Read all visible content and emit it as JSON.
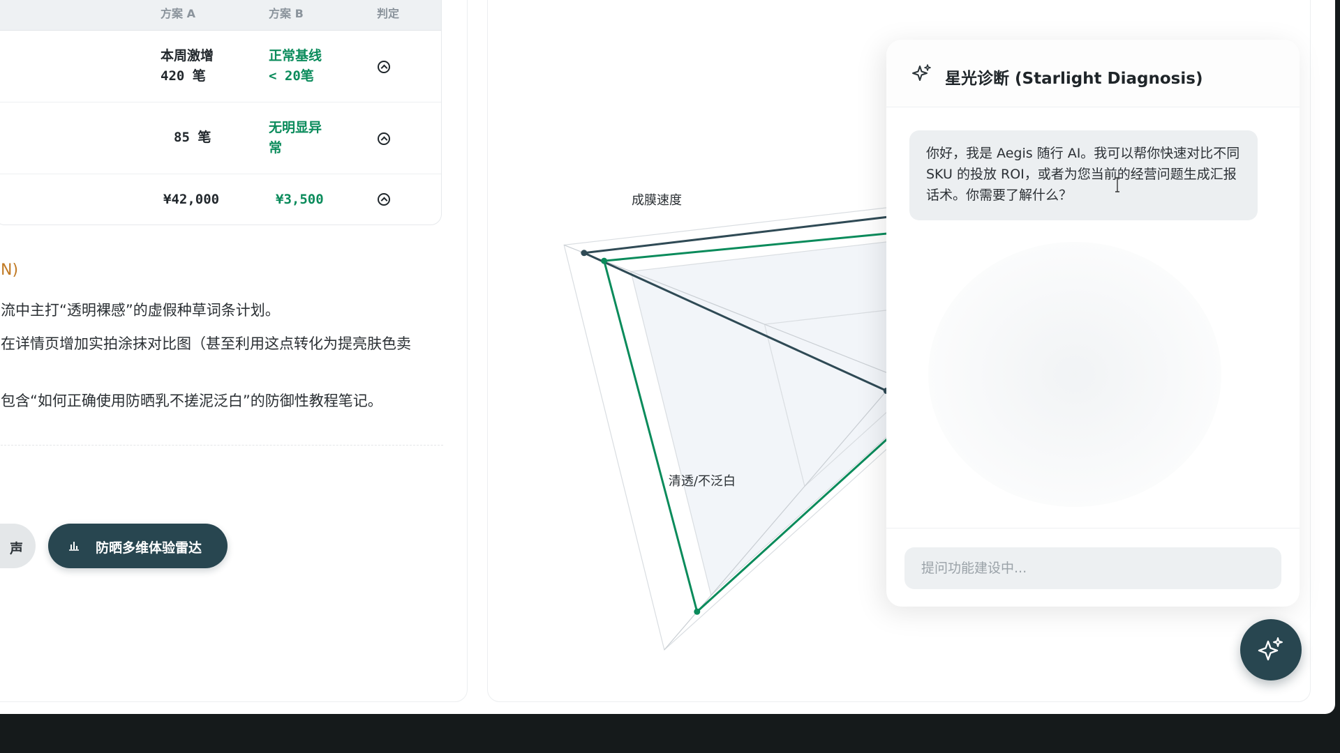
{
  "table": {
    "headers": {
      "a": "方案 A",
      "b": "方案 B",
      "verdict": "判定"
    },
    "rows": [
      {
        "a_line1": "本周激增",
        "a_line2": "420 笔",
        "b_line1": "正常基线",
        "b_line2": "< 20笔"
      },
      {
        "a_line1": "85 笔",
        "b_line1": "无明显异",
        "b_line2": "常"
      },
      {
        "a_line1": "¥42,000",
        "b_line1": "¥3,500"
      }
    ]
  },
  "section": {
    "label": "N)",
    "lines": [
      "流中主打“透明裸感”的虚假种草词条计划。",
      "在详情页增加实拍涂抹对比图（甚至利用这点转化为提亮肤色卖",
      "包含“如何正确使用防晒乳不搓泥泛白”的防御性教程笔记。"
    ]
  },
  "buttons": {
    "ghost_label": "声",
    "radar_label": "防晒多维体验雷达"
  },
  "chart_data": {
    "type": "radar",
    "axes": [
      "",
      "成膜速度",
      "清透/不泛白"
    ],
    "series": [
      {
        "color": "#2f4a55",
        "values": [
          0.95,
          0.94,
          0.05
        ]
      },
      {
        "color": "#0a8b5b",
        "values": [
          0.82,
          0.88,
          0.86
        ]
      }
    ],
    "rmax": 1
  },
  "chat": {
    "title": "星光诊断 (Starlight Diagnosis)",
    "message": "你好，我是 Aegis 随行 AI。我可以帮你快速对比不同 SKU 的投放 ROI，或者为您当前的经营问题生成汇报话术。你需要了解什么？",
    "placeholder": "提问功能建设中..."
  },
  "colors": {
    "brand_dark": "#284650",
    "green": "#0a8b5b",
    "orange": "#c17a24"
  },
  "icons": {
    "chat_header": "sparkles-icon",
    "fab": "sparkles-icon",
    "radar_button": "bar-chart-icon",
    "verdict": "chevron-up-circle-icon"
  }
}
